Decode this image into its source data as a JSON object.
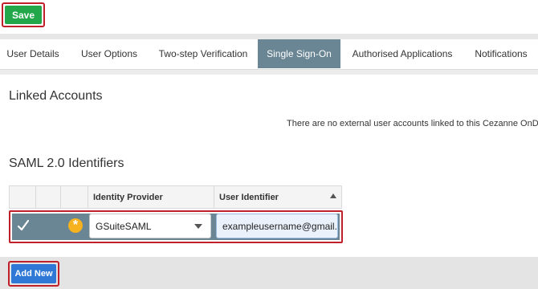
{
  "toolbar": {
    "save_label": "Save"
  },
  "tabs": [
    {
      "label": "User Details"
    },
    {
      "label": "User Options"
    },
    {
      "label": "Two-step Verification"
    },
    {
      "label": "Single Sign-On",
      "active": true
    },
    {
      "label": "Authorised Applications"
    },
    {
      "label": "Notifications"
    }
  ],
  "linked_accounts": {
    "title": "Linked Accounts",
    "empty_message": "There are no external user accounts linked to this Cezanne OnDe"
  },
  "saml": {
    "title": "SAML 2.0 Identifiers",
    "columns": [
      "",
      "",
      "",
      "Identity Provider",
      "User Identifier"
    ],
    "rows": [
      {
        "identity_provider": "GSuiteSAML",
        "user_identifier": "exampleusername@gmail.co",
        "selected": true,
        "icons": [
          "check-icon",
          "asterisk-icon"
        ]
      }
    ]
  },
  "footer": {
    "add_new_label": "Add New"
  },
  "colors": {
    "save_green": "#22a84a",
    "active_tab": "#6a8694",
    "add_new_blue": "#2f78d6",
    "highlight_red": "#c0202a",
    "asterisk_orange": "#f6b21f"
  }
}
